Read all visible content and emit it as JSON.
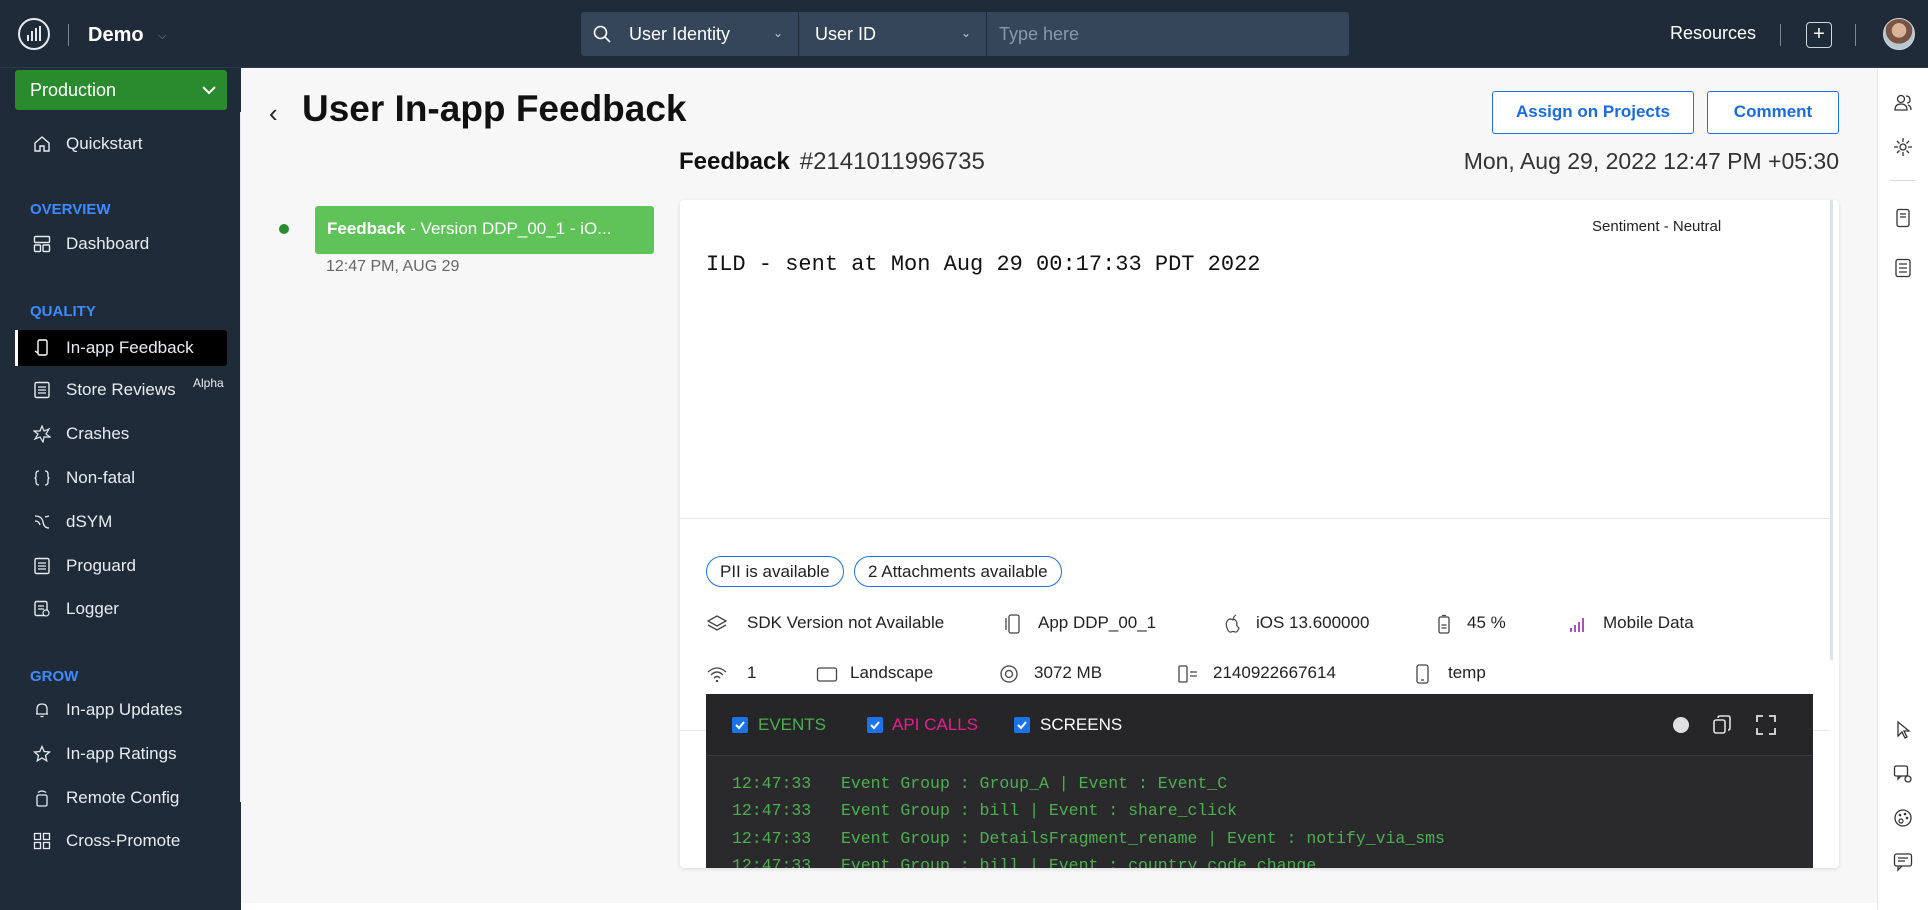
{
  "topbar": {
    "app_name": "Demo",
    "search": {
      "category": "User Identity",
      "field": "User ID",
      "placeholder": "Type here"
    },
    "resources_label": "Resources",
    "add_label": "+"
  },
  "sidebar": {
    "environment": "Production",
    "quickstart": "Quickstart",
    "sections": {
      "overview": "OVERVIEW",
      "quality": "QUALITY",
      "grow": "GROW"
    },
    "overview_items": [
      "Dashboard"
    ],
    "quality_items": [
      "In-app Feedback",
      "Store Reviews",
      "Crashes",
      "Non-fatal",
      "dSYM",
      "Proguard",
      "Logger"
    ],
    "store_reviews_badge": "Alpha",
    "grow_items": [
      "In-app Updates",
      "In-app Ratings",
      "Remote Config",
      "Cross-Promote"
    ],
    "active_item": "In-app Feedback"
  },
  "header": {
    "title": "User In-app Feedback",
    "assign_button": "Assign on Projects",
    "comment_button": "Comment"
  },
  "timeline": {
    "card_bold": "Feedback",
    "card_text": " - Version DDP_00_1 - iO...",
    "time": "12:47 PM, AUG 29"
  },
  "feedback": {
    "label": "Feedback",
    "id": "#2141011996735",
    "date": "Mon, Aug 29, 2022 12:47 PM +05:30",
    "sentiment": "Sentiment - Neutral",
    "message": "ILD - sent at Mon Aug 29 00:17:33 PDT 2022",
    "pills": [
      "PII is available",
      "2 Attachments available"
    ],
    "meta_row1": {
      "sdk": "SDK Version not Available",
      "app": "App DDP_00_1",
      "os": "iOS 13.600000",
      "battery": "45 %",
      "network": "Mobile Data"
    },
    "meta_row2": {
      "wifi": "1",
      "orientation": "Landscape",
      "memory": "3072 MB",
      "device_id": "2140922667614",
      "device_name": "temp"
    }
  },
  "console": {
    "filters": [
      {
        "label": "EVENTS",
        "color": "#4caf50"
      },
      {
        "label": "API CALLS",
        "color": "#e91e8c"
      },
      {
        "label": "SCREENS",
        "color": "#ffffff"
      }
    ],
    "logs": [
      {
        "time": "12:47:33",
        "text": "Event Group : Group_A | Event : Event_C"
      },
      {
        "time": "12:47:33",
        "text": "Event Group : bill | Event : share_click"
      },
      {
        "time": "12:47:33",
        "text": "Event Group : DetailsFragment_rename | Event : notify_via_sms"
      },
      {
        "time": "12:47:33",
        "text": "Event Group : bill | Event : country_code_change"
      }
    ]
  }
}
